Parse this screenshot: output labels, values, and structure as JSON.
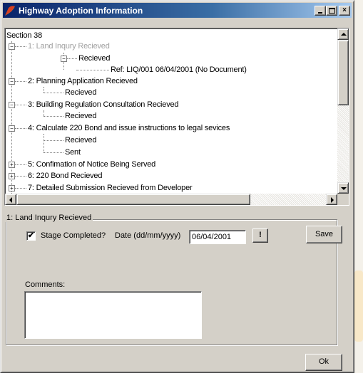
{
  "window": {
    "title": "Highway Adoption Information",
    "controls": {
      "minimize_label": "",
      "maximize_label": "",
      "close_label": "×"
    }
  },
  "tree": {
    "rows": [
      {
        "text": "Section 38",
        "greyed": false
      },
      {
        "text": "1: Land Inqury Recieved",
        "greyed": true
      },
      {
        "text": "Recieved",
        "greyed": false
      },
      {
        "text": "Ref: LIQ/001 06/04/2001 (No Document)",
        "greyed": false
      },
      {
        "text": "2: Planning Application Recieved",
        "greyed": false
      },
      {
        "text": "Recieved",
        "greyed": false
      },
      {
        "text": "3: Building Regulation Consultation Recieved",
        "greyed": false
      },
      {
        "text": "Recieved",
        "greyed": false
      },
      {
        "text": "4: Calculate 220 Bond and issue instructions to legal sevices",
        "greyed": false
      },
      {
        "text": "Recieved",
        "greyed": false
      },
      {
        "text": "Sent",
        "greyed": false
      },
      {
        "text": "5: Confimation of Notice Being Served",
        "greyed": false
      },
      {
        "text": "6: 220 Bond Recieved",
        "greyed": false
      },
      {
        "text": "7: Detailed Submission Recieved from Developer",
        "greyed": false
      }
    ],
    "expand_symbols": {
      "collapse": "−",
      "expand": "+"
    }
  },
  "stage": {
    "group_label": "1: Land Inqury Recieved",
    "completed_label": "Stage Completed?",
    "completed_checked": true,
    "checkmark": "✔",
    "date_label": "Date (dd/mm/yyyy)",
    "date_value": "06/04/2001",
    "date_button_label": "!",
    "save_label": "Save",
    "comments_label": "Comments:",
    "comments_value": ""
  },
  "footer": {
    "ok_label": "Ok"
  },
  "colors": {
    "titlebar_start": "#0a246a",
    "titlebar_end": "#a6caf0",
    "face": "#d4d0c8",
    "greyed_text": "#a0a0a0"
  }
}
